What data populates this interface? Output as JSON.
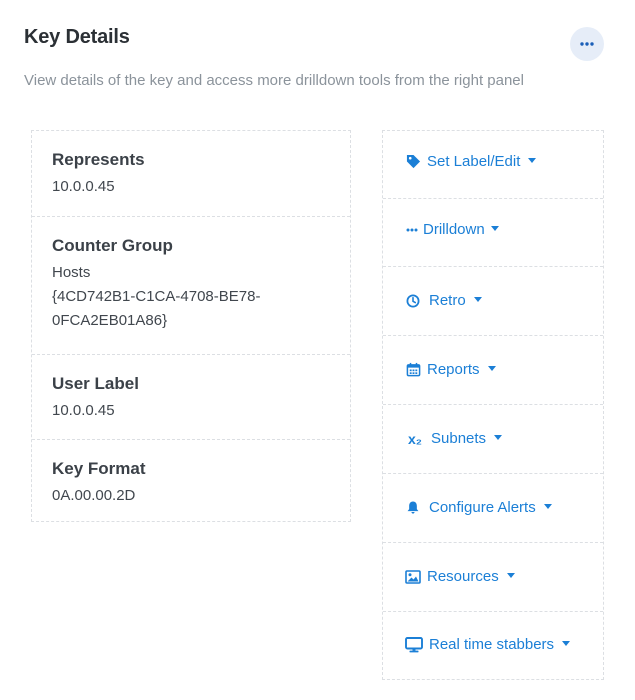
{
  "header": {
    "title": "Key Details",
    "more_button_icon": "ellipsis-icon"
  },
  "subtitle": "View details of the key and access more drilldown tools from the right panel",
  "details": [
    {
      "label": "Represents",
      "value": "10.0.0.45"
    },
    {
      "label": "Counter Group",
      "value": "Hosts\n{4CD742B1-C1CA-4708-BE78-\n0FCA2EB01A86}"
    },
    {
      "label": "User Label",
      "value": "10.0.0.45"
    },
    {
      "label": "Key Format",
      "value": "0A.00.00.2D"
    }
  ],
  "actions": [
    {
      "label": "Set Label/Edit",
      "icon": "tag-icon"
    },
    {
      "label": "Drilldown",
      "icon": "ellipsis-icon"
    },
    {
      "label": "Retro",
      "icon": "clock-icon"
    },
    {
      "label": "Reports",
      "icon": "calendar-icon"
    },
    {
      "label": "Subnets",
      "icon": "subscript-icon",
      "icon_text": "x₂"
    },
    {
      "label": "Configure Alerts",
      "icon": "bell-icon"
    },
    {
      "label": "Resources",
      "icon": "image-icon"
    },
    {
      "label": "Real time stabbers",
      "icon": "monitor-icon"
    }
  ],
  "colors": {
    "accent": "#1b7fd6",
    "text": "#3b4148",
    "muted": "#8b939b",
    "border": "#dcdfe3"
  }
}
